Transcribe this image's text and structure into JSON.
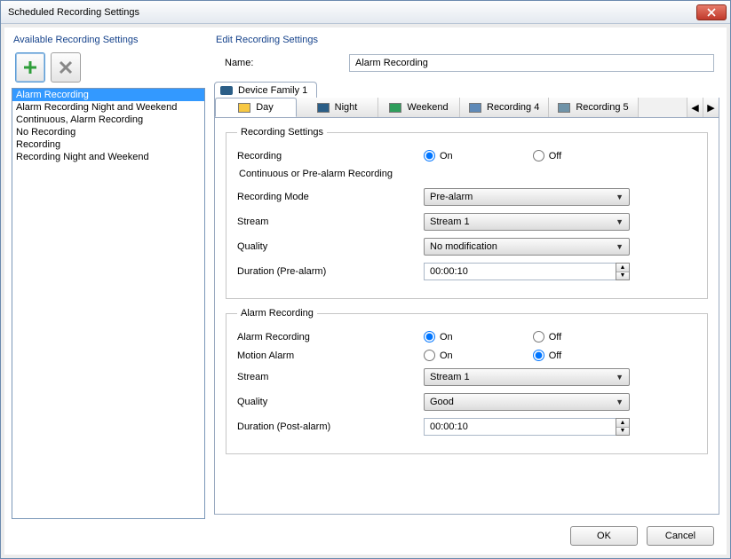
{
  "window": {
    "title": "Scheduled Recording Settings"
  },
  "left": {
    "header": "Available Recording Settings",
    "items": [
      "Alarm Recording",
      "Alarm Recording Night and Weekend",
      "Continuous, Alarm Recording",
      "No Recording",
      "Recording",
      "Recording Night and Weekend"
    ]
  },
  "right": {
    "header": "Edit Recording Settings",
    "name_label": "Name:",
    "name_value": "Alarm Recording",
    "outer_tab": "Device Family 1",
    "inner_tabs": [
      "Day",
      "Night",
      "Weekend",
      "Recording 4",
      "Recording 5"
    ]
  },
  "recording_settings": {
    "legend": "Recording Settings",
    "recording_label": "Recording",
    "on": "On",
    "off": "Off",
    "recording_value": "On",
    "cont_header": "Continuous or Pre-alarm Recording",
    "mode_label": "Recording Mode",
    "mode_value": "Pre-alarm",
    "stream_label": "Stream",
    "stream_value": "Stream 1",
    "quality_label": "Quality",
    "quality_value": "No modification",
    "duration_label": "Duration (Pre-alarm)",
    "duration_value": "00:00:10"
  },
  "alarm_recording": {
    "legend": "Alarm Recording",
    "alarm_label": "Alarm Recording",
    "on": "On",
    "off": "Off",
    "alarm_value": "On",
    "motion_label": "Motion Alarm",
    "motion_value": "Off",
    "stream_label": "Stream",
    "stream_value": "Stream 1",
    "quality_label": "Quality",
    "quality_value": "Good",
    "duration_label": "Duration (Post-alarm)",
    "duration_value": "00:00:10"
  },
  "footer": {
    "ok": "OK",
    "cancel": "Cancel"
  }
}
